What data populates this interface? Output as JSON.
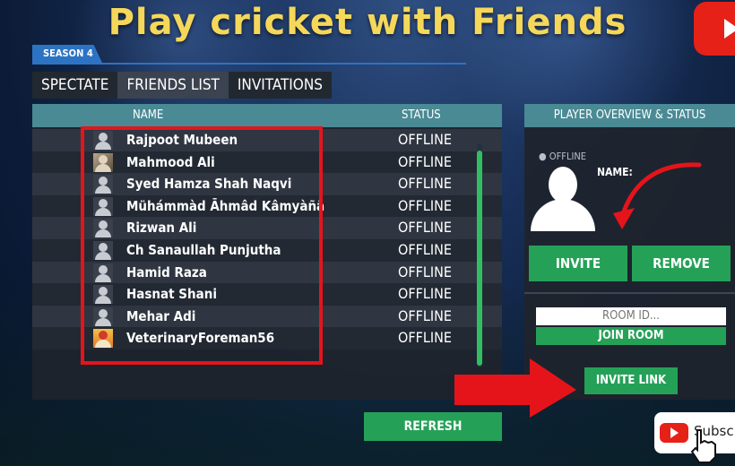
{
  "title": "Play cricket with  Friends",
  "season_label": "SEASON 4",
  "tabs": [
    {
      "label": "SPECTATE",
      "active": false
    },
    {
      "label": "FRIENDS LIST",
      "active": true
    },
    {
      "label": "INVITATIONS",
      "active": false
    }
  ],
  "friends_table": {
    "headers": {
      "name": "NAME",
      "status": "STATUS"
    },
    "rows": [
      {
        "name": "Rajpoot Mubeen",
        "status": "OFFLINE",
        "avatar": "default-avatar"
      },
      {
        "name": "Mahmood Ali",
        "status": "OFFLINE",
        "avatar": "photo-avatar"
      },
      {
        "name": "Syed Hamza Shah Naqvi",
        "status": "OFFLINE",
        "avatar": "default-avatar"
      },
      {
        "name": "Mühámmàd Āhmâd Kâmyàñã",
        "status": "OFFLINE",
        "avatar": "default-avatar"
      },
      {
        "name": "Rizwan Ali",
        "status": "OFFLINE",
        "avatar": "default-avatar"
      },
      {
        "name": "Ch Sanaullah Punjutha",
        "status": "OFFLINE",
        "avatar": "default-avatar"
      },
      {
        "name": "Hamid Raza",
        "status": "OFFLINE",
        "avatar": "default-avatar"
      },
      {
        "name": "Hasnat Shani",
        "status": "OFFLINE",
        "avatar": "default-avatar"
      },
      {
        "name": "Mehar Adi",
        "status": "OFFLINE",
        "avatar": "default-avatar"
      },
      {
        "name": "VeterinaryForeman56",
        "status": "OFFLINE",
        "avatar": "photo-avatar"
      }
    ]
  },
  "refresh_label": "REFRESH",
  "overview": {
    "header": "PLAYER OVERVIEW & STATUS",
    "status": "OFFLINE",
    "name_label": "NAME:",
    "invite_label": "INVITE",
    "remove_label": "REMOVE",
    "room_placeholder": "ROOM ID...",
    "join_label": "JOIN ROOM",
    "invite_link_label": "INVITE LINK"
  },
  "subscribe_label": "Subsc",
  "colors": {
    "accent_green": "#25a157",
    "header_teal": "#4a8a94",
    "highlight_red": "#e5141b",
    "title_yellow": "#f5d85a"
  }
}
